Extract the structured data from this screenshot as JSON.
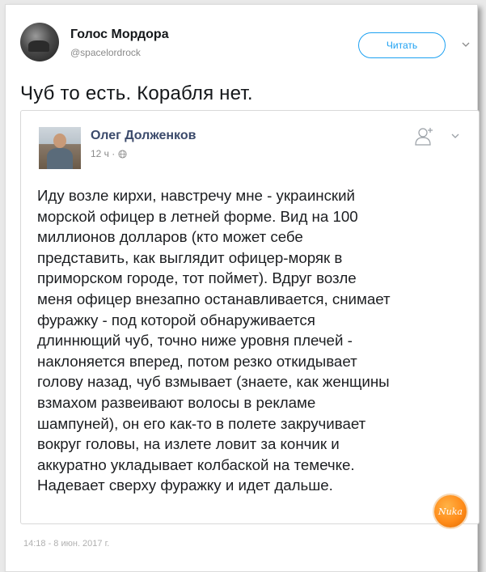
{
  "tweet": {
    "author_name": "Голос Мордора",
    "author_handle": "@spacelordrock",
    "follow_label": "Читать",
    "text": "Чуб то есть. Корабля нет.",
    "footer_date": "14:18 - 8 июн. 2017 г."
  },
  "quoted_post": {
    "author_name": "Олег Долженков",
    "time": "12 ч ·",
    "body_lines": [
      "Иду возле кирхи, навстречу мне - украинский",
      "морской офицер в летней форме. Вид на 100",
      "миллионов долларов (кто может себе",
      "представить, как выглядит офицер-моряк в",
      "приморском городе, тот поймет). Вдруг возле",
      "меня офицер внезапно останавливается, снимает",
      "фуражку - под которой обнаруживается",
      "длиннющий чуб, точно ниже уровня плечей -",
      "наклоняется вперед, потом резко откидывает",
      "голову назад, чуб взмывает (знаете, как женщины",
      "взмахом развеивают волосы в рекламе",
      "шампуней), он его как-то в полете закручивает",
      "вокруг головы, на излете ловит за кончик и",
      "аккуратно укладывает колбаской на темечке.",
      "Надевает сверху фуражку и идет дальше."
    ]
  },
  "watermark": {
    "label": "Nuka"
  },
  "colors": {
    "accent": "#1da1f2",
    "fb_name": "#3b4a6b",
    "badge": "#ff8c1a"
  },
  "icons": [
    "chevron-down-icon",
    "globe-icon",
    "add-friend-icon"
  ]
}
